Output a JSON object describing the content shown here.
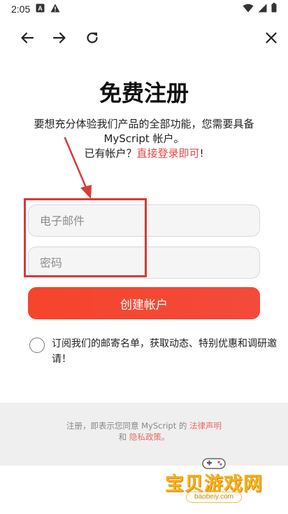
{
  "status_bar": {
    "time": "2:05"
  },
  "nav": {
    "back_icon": "arrow-left-icon",
    "forward_icon": "arrow-right-icon",
    "reload_icon": "reload-icon",
    "close_icon": "close-icon"
  },
  "title": "免费注册",
  "intro": {
    "line1": "要想充分体验我们产品的全部功能，您需要具备",
    "line2": "MyScript 帐户。",
    "login_prefix": "已有帐户？",
    "login_link": "直接登录即可",
    "login_suffix": "!"
  },
  "form": {
    "email_placeholder": "电子邮件",
    "password_placeholder": "密码",
    "create_button": "创建帐户"
  },
  "subscribe": {
    "text": "订阅我们的邮寄名单，获取动态、特别优惠和调研邀请！"
  },
  "footer": {
    "prefix": "注册，即表示您同意 MyScript 的",
    "terms_link": "法律声明",
    "and": "和",
    "privacy_link": "隐私政策",
    "end": "。"
  },
  "watermark": {
    "name": "宝贝游戏网",
    "url": "baobeiy.com"
  },
  "colors": {
    "accent": "#f4472f",
    "link": "#e84545",
    "annotation": "#d83a3a"
  }
}
